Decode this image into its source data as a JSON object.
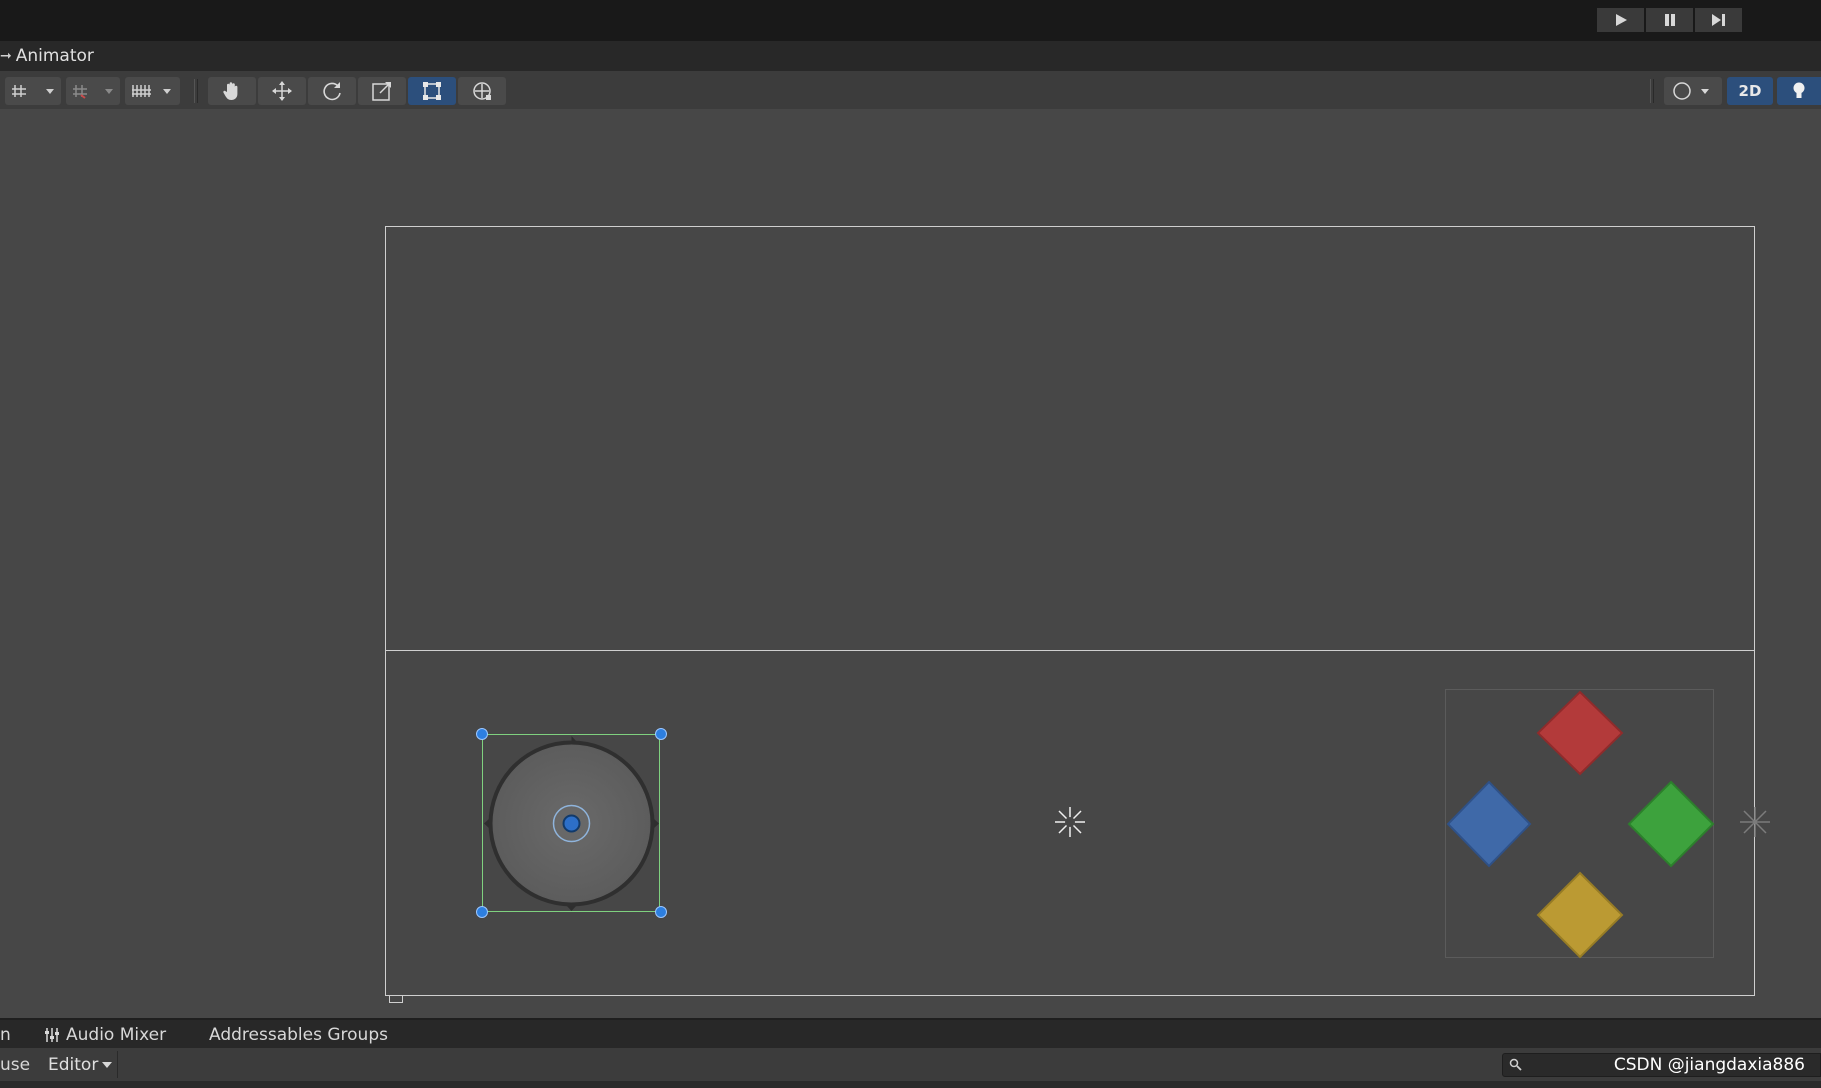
{
  "window": {
    "tab_title": "Animator"
  },
  "playbar": {
    "play_icon": "play-icon",
    "pause_icon": "pause-icon",
    "step_icon": "step-icon"
  },
  "toolbar": {
    "left_tools": [
      "grid-snap-icon",
      "incremental-snap-icon",
      "grid-visibility-icon"
    ],
    "tools": [
      "hand-tool-icon",
      "move-tool-icon",
      "rotate-tool-icon",
      "scale-tool-icon",
      "rect-tool-icon",
      "transform-tool-icon"
    ],
    "active_tool": "rect-tool-icon",
    "mode_2d_label": "2D",
    "light_toggle": "light-icon",
    "gizmo_dropdown": "gizmo-sphere-icon"
  },
  "scene": {
    "selected_object": "joystick",
    "button_colors": {
      "top": "#b33a3a",
      "left": "#3f69a8",
      "right": "#3da23d",
      "bottom": "#bb9a33"
    }
  },
  "bottom_tabs": {
    "partial_left": "n",
    "audio_mixer": "Audio Mixer",
    "addressables": "Addressables Groups"
  },
  "bottom_bar": {
    "partial_left": "use",
    "editor_label": "Editor",
    "watermark": "CSDN @jiangdaxia886"
  }
}
